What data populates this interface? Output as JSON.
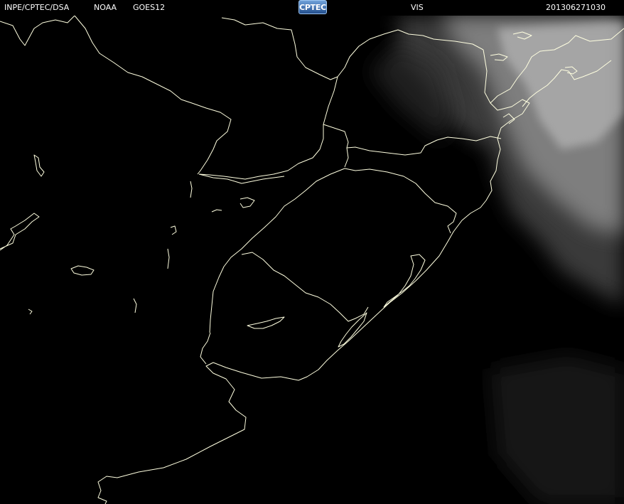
{
  "header": {
    "institution": "INPE/CPTEC/DSA",
    "agency": "NOAA",
    "satellite": "GOES12",
    "channel": "VIS",
    "timestamp": "201306271030"
  },
  "logo": {
    "text": "CPTEC"
  },
  "colors": {
    "background": "#000000",
    "border_lines": "#ffffe0",
    "cloud_bright": "#b8b8b8",
    "cloud_dim": "#3a3a3a"
  }
}
